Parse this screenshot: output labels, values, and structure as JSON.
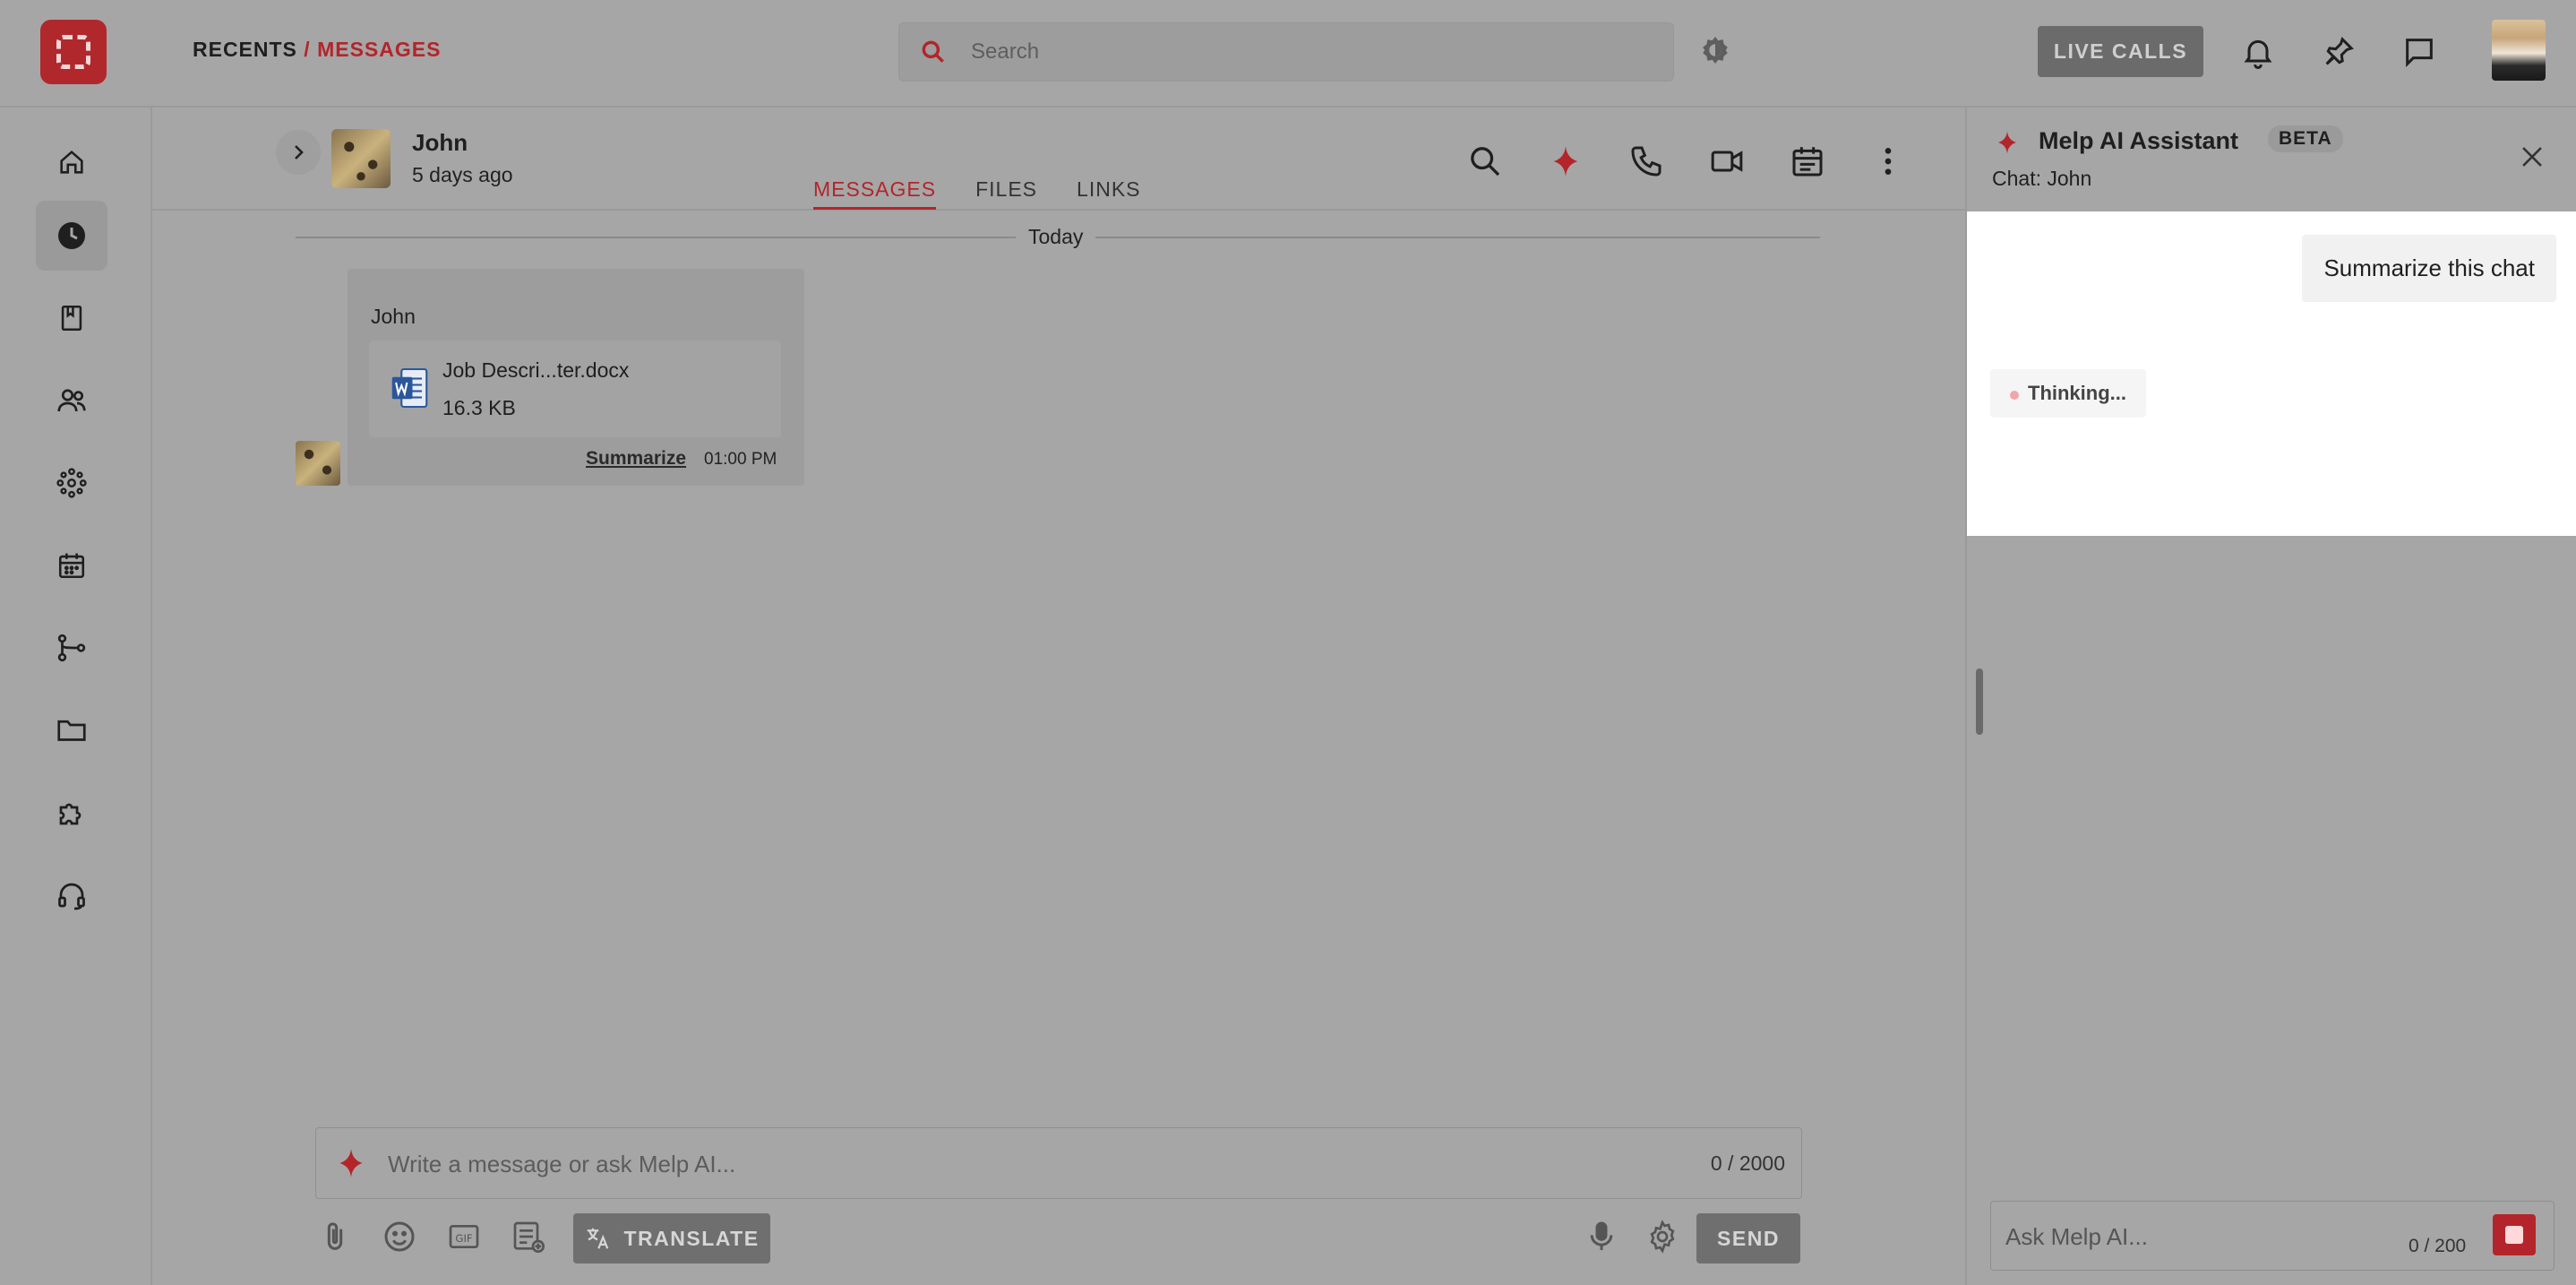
{
  "breadcrumb": {
    "root": "RECENTS",
    "separator": "/",
    "current": "MESSAGES"
  },
  "search": {
    "placeholder": "Search"
  },
  "topbar": {
    "live_calls_label": "LIVE CALLS"
  },
  "left_nav": [
    {
      "id": "home",
      "icon": "home-icon"
    },
    {
      "id": "recents",
      "icon": "clock-icon",
      "active": true
    },
    {
      "id": "bookmarks",
      "icon": "bookmark-icon"
    },
    {
      "id": "contacts",
      "icon": "users-icon"
    },
    {
      "id": "network",
      "icon": "network-icon"
    },
    {
      "id": "calendar",
      "icon": "calendar-icon"
    },
    {
      "id": "workflow",
      "icon": "workflow-icon"
    },
    {
      "id": "files",
      "icon": "folder-icon"
    },
    {
      "id": "apps",
      "icon": "puzzle-icon"
    },
    {
      "id": "support",
      "icon": "headset-icon"
    }
  ],
  "chat": {
    "contact_name": "John",
    "contact_status": "5 days ago",
    "tabs": [
      {
        "label": "MESSAGES",
        "active": true
      },
      {
        "label": "FILES",
        "active": false
      },
      {
        "label": "LINKS",
        "active": false
      }
    ]
  },
  "messages": {
    "date_divider": "Today",
    "items": [
      {
        "sender": "John",
        "file_name": "Job Descri...ter.docx",
        "file_size": "16.3 KB",
        "action_label": "Summarize",
        "time": "01:00 PM"
      }
    ]
  },
  "composer": {
    "placeholder": "Write a message or ask Melp AI...",
    "char_count": "0 / 2000",
    "translate_label": "TRANSLATE",
    "send_label": "SEND"
  },
  "ai_panel": {
    "title": "Melp AI Assistant",
    "badge": "BETA",
    "subtitle": "Chat: John",
    "user_prompt": "Summarize this chat",
    "status": "Thinking...",
    "input_placeholder": "Ask Melp AI...",
    "char_count": "0 / 200"
  },
  "colors": {
    "accent": "#b3252a",
    "overlay_gray": "#a6a6a6",
    "panel_white": "#ffffff"
  }
}
